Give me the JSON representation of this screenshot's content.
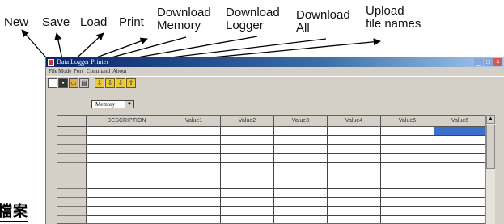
{
  "callouts": {
    "new": "New",
    "save": "Save",
    "load": "Load",
    "print": "Print",
    "download_memory": "Download\nMemory",
    "download_logger": "Download\nLogger",
    "download_all": "Download\nAll",
    "upload_file_names": "Upload\nfile names"
  },
  "side_text": "檔案",
  "window": {
    "title": "Data Logger Printer",
    "menu": [
      "File",
      "Mode",
      "Port",
      "Command",
      "About"
    ],
    "toolbar": {
      "new": "new-file-icon",
      "save": "save-disk-icon",
      "load": "open-folder-icon",
      "print": "printer-icon",
      "download_memory": "download-memory-icon",
      "download_logger": "download-logger-icon",
      "download_all": "download-all-icon",
      "upload": "upload-file-names-icon"
    },
    "source_select": {
      "value": "Memory"
    },
    "table": {
      "columns": [
        "",
        "DESCRIPTION",
        "Value1",
        "Value2",
        "Value3",
        "Value4",
        "Value5",
        "Value6"
      ]
    }
  },
  "colors": {
    "titlebar": "#0a246a",
    "window_face": "#d4d0c8",
    "selected_cell": "#3b6fcc"
  }
}
